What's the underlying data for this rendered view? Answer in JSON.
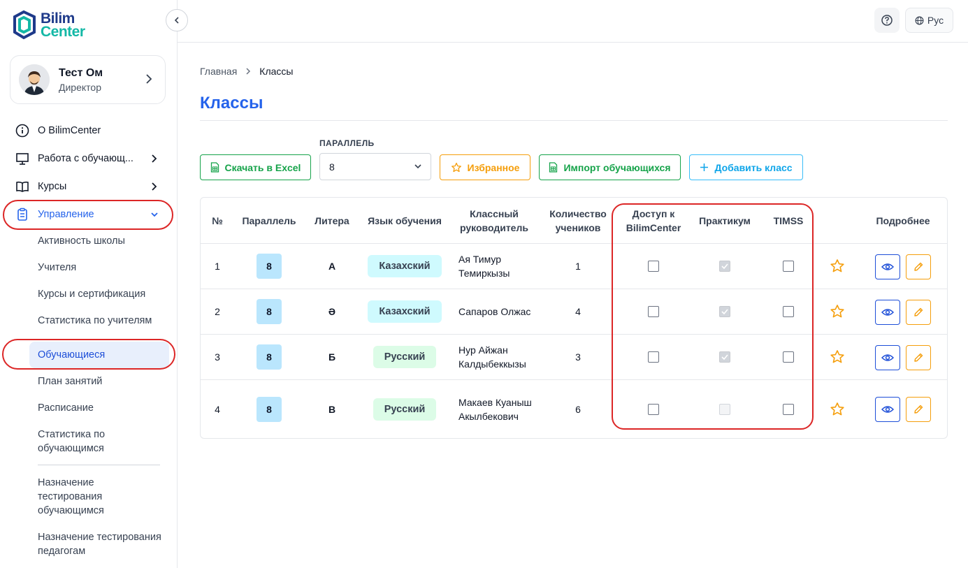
{
  "brand": {
    "line1": "Bilim",
    "line2": "Center"
  },
  "profile": {
    "name": "Тест Ом",
    "role": "Директор"
  },
  "nav": {
    "about": "О BilimCenter",
    "students_work": "Работа с обучающ...",
    "courses": "Курсы",
    "management": "Управление"
  },
  "subnav": [
    "Активность школы",
    "Учителя",
    "Курсы и сертификация",
    "Статистика по учителям",
    "Обучающиеся",
    "План занятий",
    "Расписание",
    "Статистика по обучающимся",
    "Назначение тестирования обучающимся",
    "Назначение тестирования педагогам"
  ],
  "header": {
    "lang": "Рус"
  },
  "breadcrumb": {
    "home": "Главная",
    "current": "Классы"
  },
  "page": {
    "title": "Классы"
  },
  "toolbar": {
    "excel": "Скачать в Excel",
    "filter_label": "ПАРАЛЛЕЛЬ",
    "filter_value": "8",
    "favorites": "Избранное",
    "import": "Импорт обучающихся",
    "add": "Добавить класс"
  },
  "table": {
    "headers": {
      "num": "№",
      "parallel": "Параллель",
      "litera": "Литера",
      "lang": "Язык обучения",
      "teacher": "Классный руководитель",
      "count": "Количество учеников",
      "access": "Доступ к BilimCenter",
      "practicum": "Практикум",
      "timss": "TIMSS",
      "details": "Подробнее"
    },
    "rows": [
      {
        "num": "1",
        "parallel": "8",
        "litera": "А",
        "lang": "Казахский",
        "teacher": "Ая Тимур Темиркызы",
        "count": "1",
        "access": false,
        "practicum": "checked",
        "timss": false
      },
      {
        "num": "2",
        "parallel": "8",
        "litera": "Ә",
        "lang": "Казахский",
        "teacher": "Сапаров Олжас",
        "count": "4",
        "access": false,
        "practicum": "checked",
        "timss": false
      },
      {
        "num": "3",
        "parallel": "8",
        "litera": "Б",
        "lang": "Русский",
        "teacher": "Нур Айжан Калдыбеккызы",
        "count": "3",
        "access": false,
        "practicum": "checked",
        "timss": false
      },
      {
        "num": "4",
        "parallel": "8",
        "litera": "В",
        "lang": "Русский",
        "teacher": "Макаев Куаныш Акылбекович",
        "count": "6",
        "access": false,
        "practicum": "disabled",
        "timss": false
      }
    ]
  },
  "colors": {
    "accent": "#2563eb",
    "green": "#16a34a",
    "orange": "#f59e0b",
    "highlight": "#dc2626"
  }
}
